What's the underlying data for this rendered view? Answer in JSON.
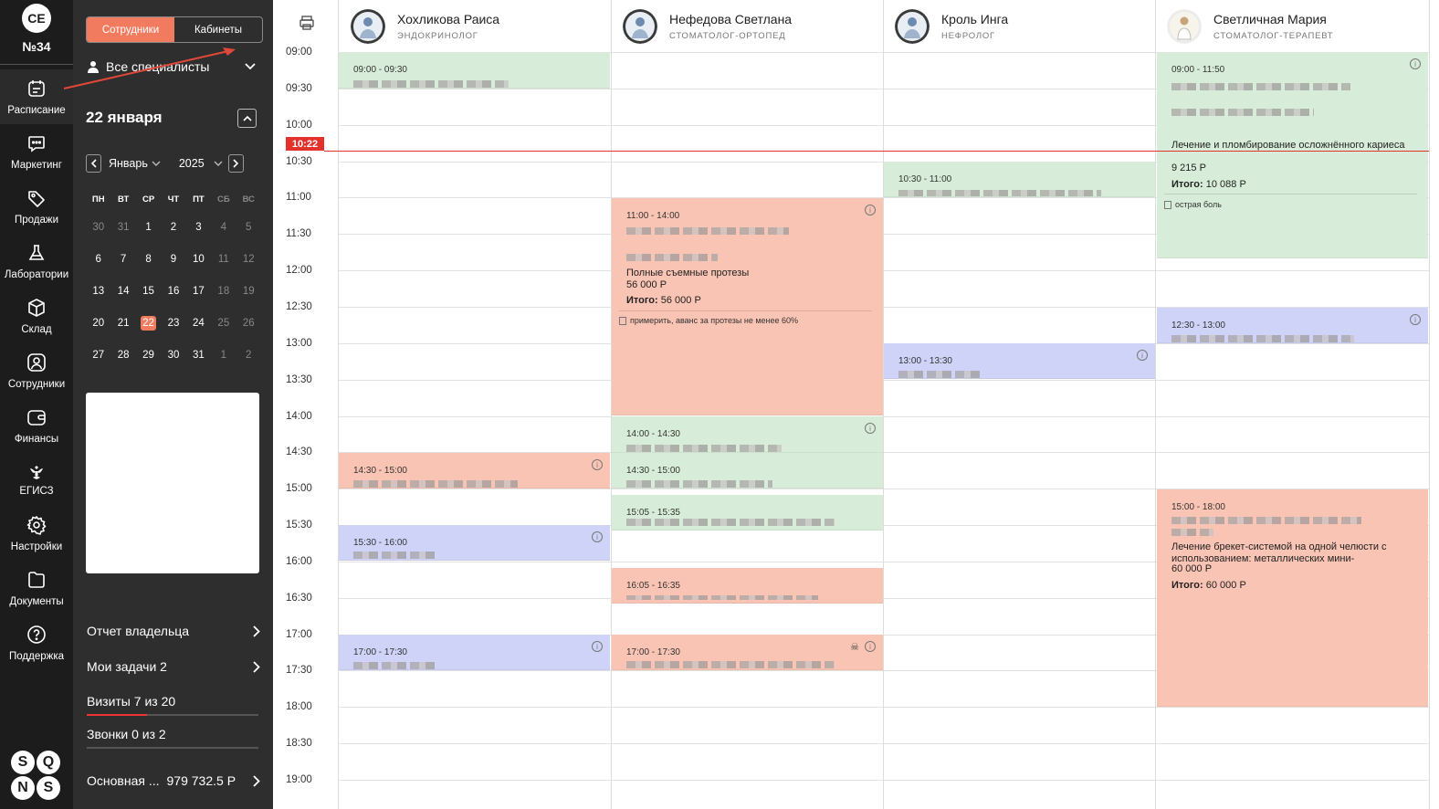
{
  "nav": {
    "avatar_initials": "СЕ",
    "clinic_number": "№34",
    "items": [
      {
        "label": "Расписание",
        "icon": "calendar-icon",
        "active": true
      },
      {
        "label": "Маркетинг",
        "icon": "chat-icon"
      },
      {
        "label": "Продажи",
        "icon": "tag-icon"
      },
      {
        "label": "Лаборатории",
        "icon": "flask-icon"
      },
      {
        "label": "Склад",
        "icon": "box-icon"
      },
      {
        "label": "Сотрудники",
        "icon": "user-icon"
      },
      {
        "label": "Финансы",
        "icon": "wallet-icon"
      },
      {
        "label": "ЕГИСЗ",
        "icon": "emblem-icon"
      },
      {
        "label": "Настройки",
        "icon": "gear-icon"
      },
      {
        "label": "Документы",
        "icon": "folder-icon"
      },
      {
        "label": "Поддержка",
        "icon": "help-icon"
      }
    ],
    "logo_letters": [
      "S",
      "Q",
      "N",
      "S"
    ]
  },
  "panel": {
    "tabs": [
      {
        "label": "Сотрудники",
        "active": true
      },
      {
        "label": "Кабинеты"
      }
    ],
    "specialists_select": "Все специалисты",
    "date_title": "22 января",
    "month": "Январь",
    "year": "2025",
    "weekdays": [
      "ПН",
      "ВТ",
      "СР",
      "ЧТ",
      "ПТ",
      "СБ",
      "ВС"
    ],
    "weeks": [
      [
        "30",
        "31",
        "1",
        "2",
        "3",
        "4",
        "5"
      ],
      [
        "6",
        "7",
        "8",
        "9",
        "10",
        "11",
        "12"
      ],
      [
        "13",
        "14",
        "15",
        "16",
        "17",
        "18",
        "19"
      ],
      [
        "20",
        "21",
        "22",
        "23",
        "24",
        "25",
        "26"
      ],
      [
        "27",
        "28",
        "29",
        "30",
        "31",
        "1",
        "2"
      ]
    ],
    "today": "22",
    "links": {
      "owner_report": "Отчет владельца",
      "my_tasks": "Мои задачи 2",
      "visits": "Визиты 7 из 20",
      "calls": "Звонки 0 из 2",
      "balance_label": "Основная ...",
      "balance_value": "979 732.5 Р"
    },
    "visits_progress": 0.35,
    "calls_progress": 0
  },
  "schedule": {
    "current_time": "10:22",
    "times": [
      "09:00",
      "09:30",
      "10:00",
      "10:30",
      "11:00",
      "11:30",
      "12:00",
      "12:30",
      "13:00",
      "13:30",
      "14:00",
      "14:30",
      "15:00",
      "15:30",
      "16:00",
      "16:30",
      "17:00",
      "17:30",
      "18:00",
      "18:30",
      "19:00"
    ],
    "doctors": [
      {
        "name": "Хохликова Раиса",
        "role": "ЭНДОКРИНОЛОГ"
      },
      {
        "name": "Нефедова Светлана",
        "role": "СТОМАТОЛОГ-ОРТОПЕД"
      },
      {
        "name": "Кроль Инга",
        "role": "НЕФРОЛОГ"
      },
      {
        "name": "Светличная Мария",
        "role": "СТОМАТОЛОГ-ТЕРАПЕВТ"
      }
    ],
    "appointments": {
      "a1": {
        "time": "09:00 - 09:30"
      },
      "a2": {
        "time": "14:30 - 15:00"
      },
      "a3": {
        "time": "15:30 - 16:00"
      },
      "a4": {
        "time": "17:00 - 17:30"
      },
      "b1": {
        "time": "11:00 - 14:00",
        "service": "Полные съемные протезы",
        "price": "56 000 Р",
        "total_label": "Итого:",
        "total": "56 000 Р",
        "note": "примерить, аванс за протезы не менее 60%"
      },
      "b2": {
        "time": "14:00 - 14:30"
      },
      "b3": {
        "time": "14:30 - 15:00"
      },
      "b4": {
        "time": "15:05 - 15:35"
      },
      "b5": {
        "time": "16:05 - 16:35"
      },
      "b6": {
        "time": "17:00 - 17:30"
      },
      "c1": {
        "time": "10:30 - 11:00"
      },
      "c2": {
        "time": "13:00 - 13:30"
      },
      "d1": {
        "time": "09:00 - 11:50",
        "service": "Лечение и пломбирование осложнённого кариеса",
        "price": "9 215 Р",
        "total_label": "Итого:",
        "total": "10 088 Р",
        "note": "острая боль"
      },
      "d2": {
        "time": "12:30 - 13:00"
      },
      "d3": {
        "time": "15:00 - 18:00",
        "service": "Лечение брекет-системой на одной челюсти с использованием: металлических мини-",
        "price": "60 000 Р",
        "total_label": "Итого:",
        "total": "60 000 Р"
      }
    }
  }
}
